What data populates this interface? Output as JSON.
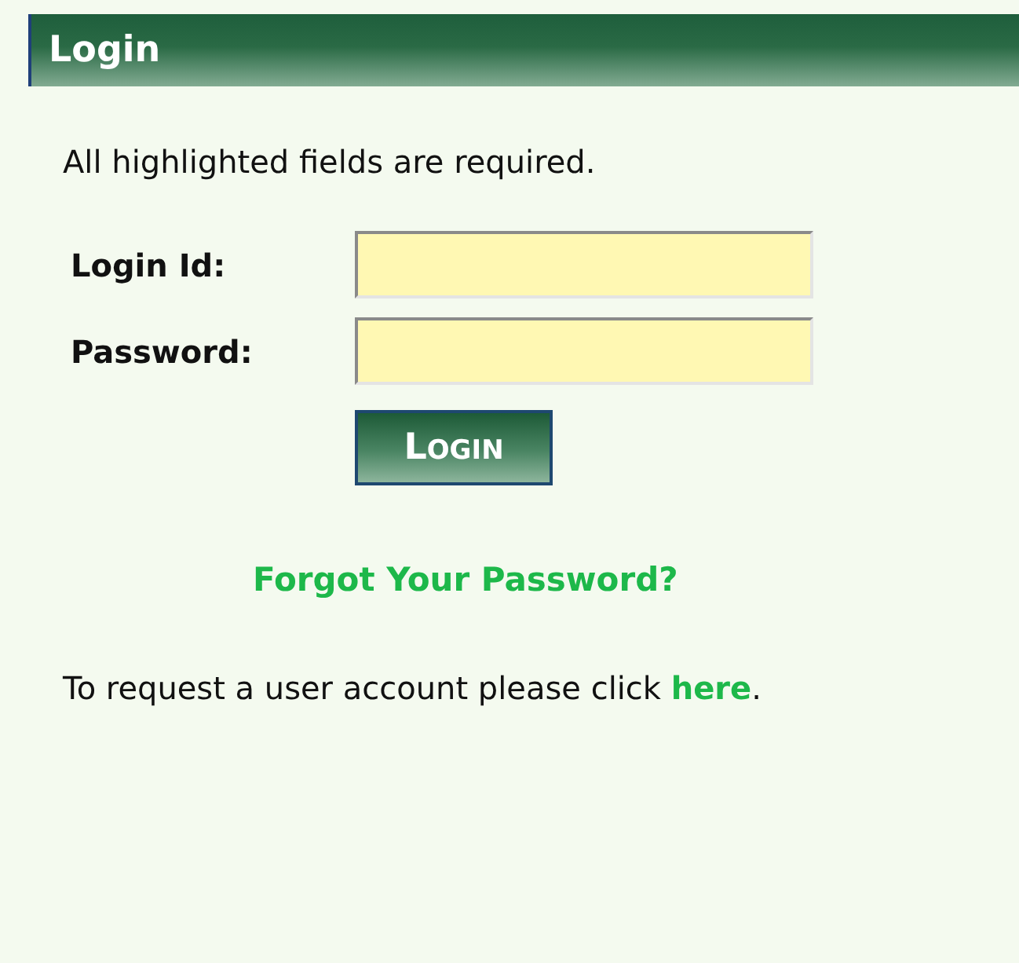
{
  "panel": {
    "title": "Login"
  },
  "instructions": "All highlighted fields are required.",
  "fields": [
    {
      "label": "Login Id:",
      "required": true
    },
    {
      "label": "Password:",
      "required": true
    }
  ],
  "login_button": "LOGIN",
  "forgot_link": "Forgot Your Password?",
  "request_text": {
    "before": "To request a user account please click ",
    "link": "here",
    "after": "."
  }
}
